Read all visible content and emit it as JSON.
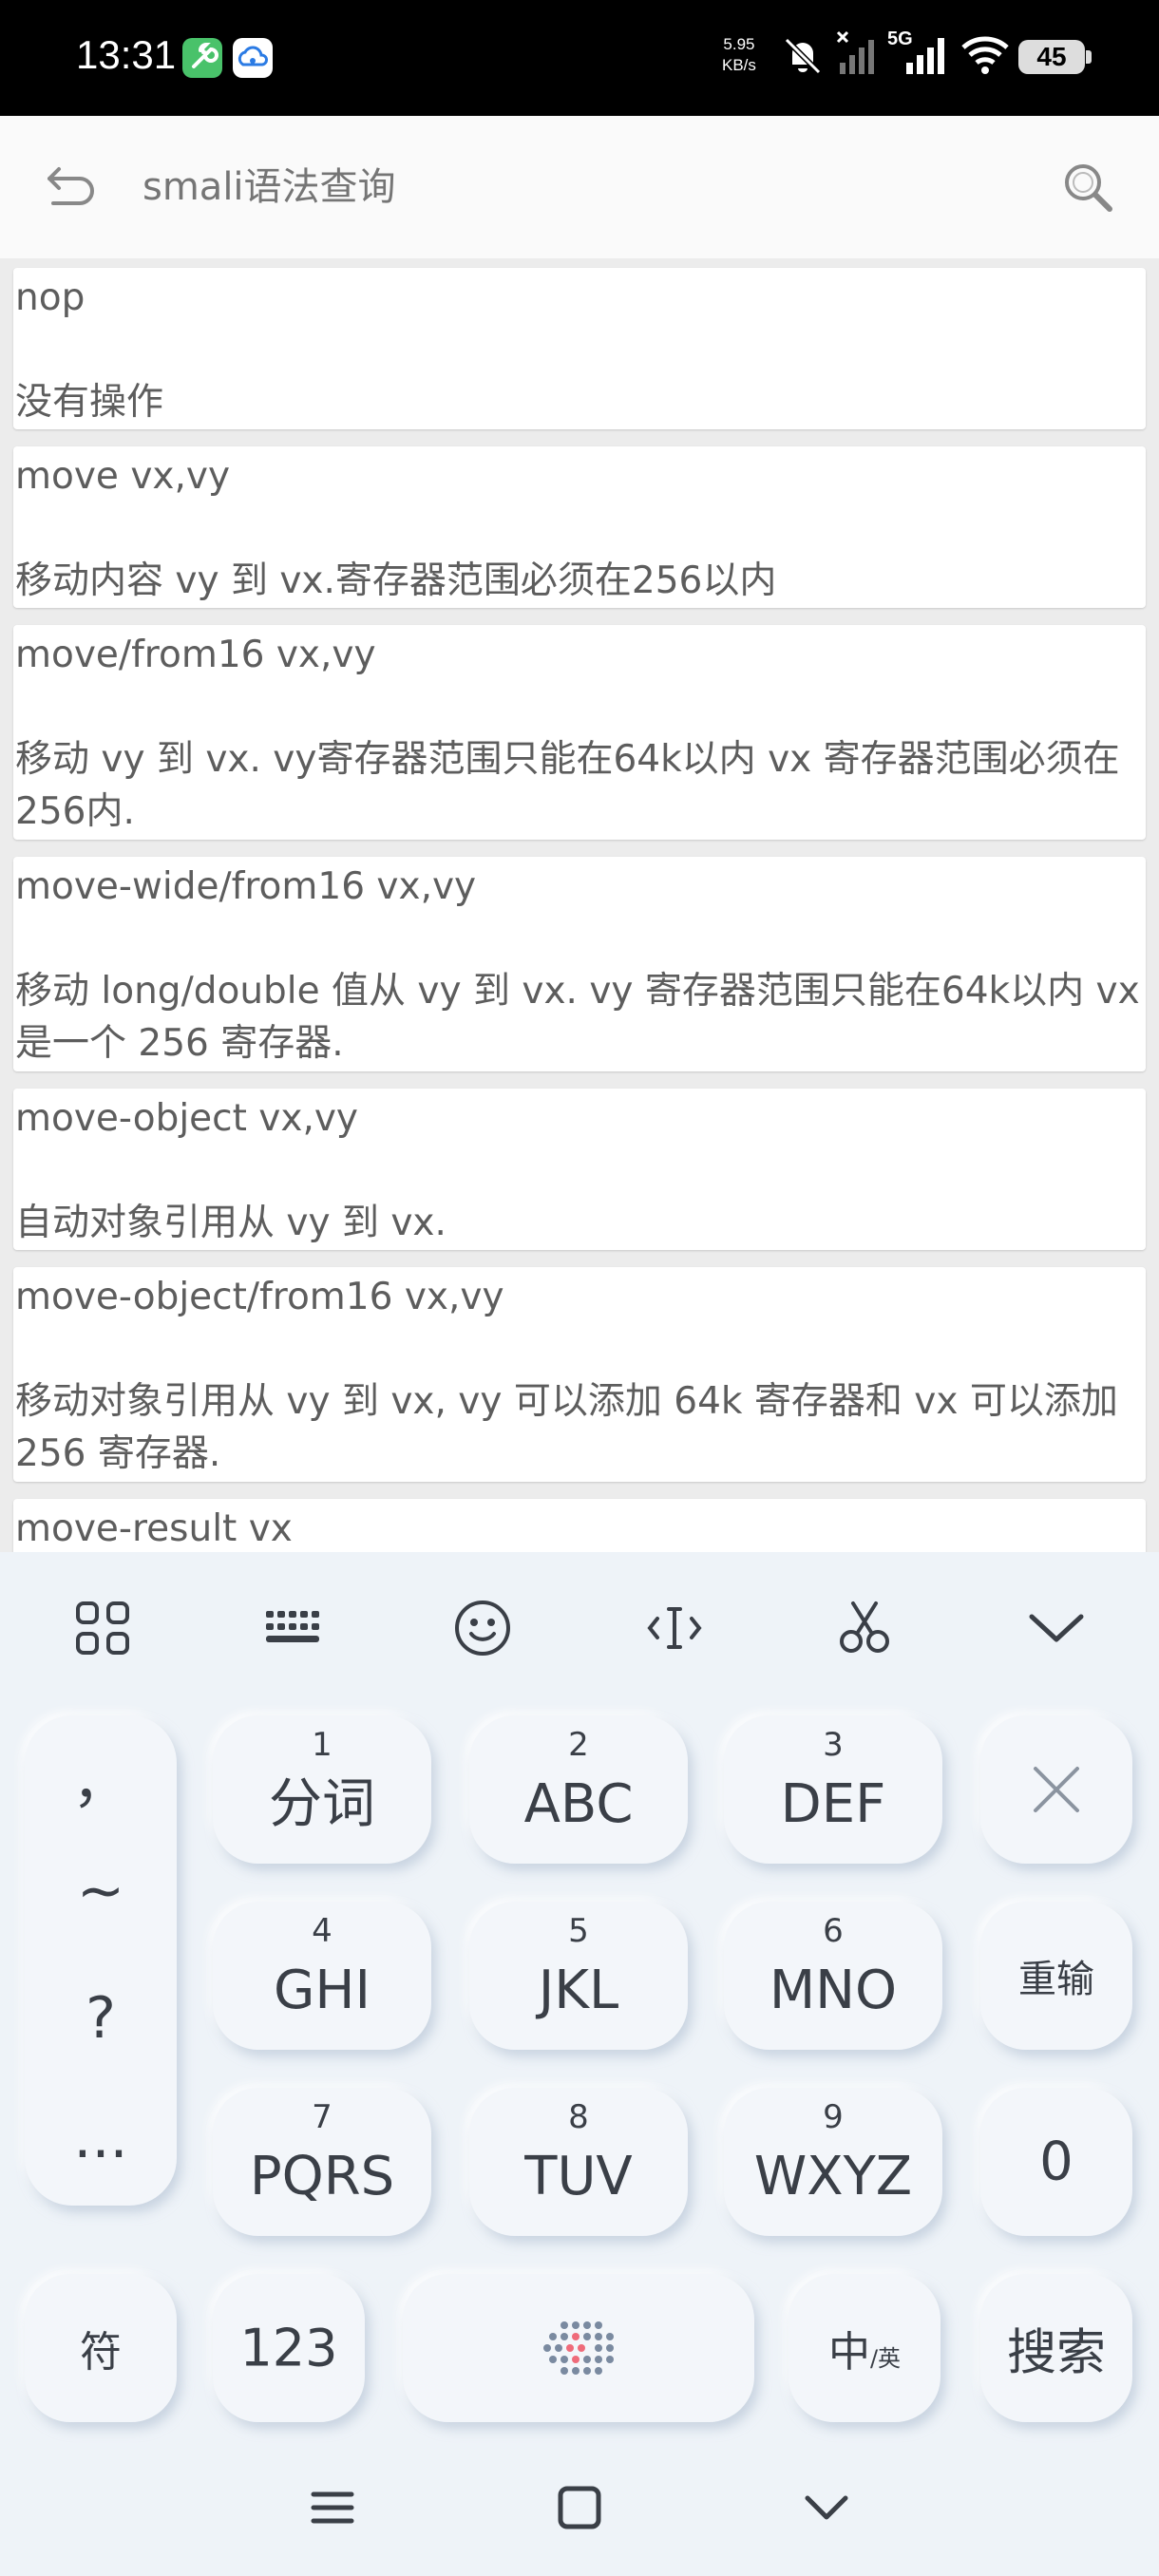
{
  "status_bar": {
    "time": "13:31",
    "net_speed_value": "5.95",
    "net_speed_unit": "KB/s",
    "network_label": "5G",
    "battery": "45"
  },
  "app_bar": {
    "search_placeholder": "smali语法查询"
  },
  "entries": [
    {
      "cmd": "nop",
      "desc": "没有操作"
    },
    {
      "cmd": "move vx,vy",
      "desc": "移动内容 vy 到 vx.寄存器范围必须在256以内"
    },
    {
      "cmd": "move/from16 vx,vy",
      "desc": "移动 vy 到 vx. vy寄存器范围只能在64k以内 vx 寄存器范围必须在256内."
    },
    {
      "cmd": "move-wide/from16 vx,vy",
      "desc": "移动 long/double 值从 vy 到 vx. vy 寄存器范围只能在64k以内 vx是一个 256 寄存器."
    },
    {
      "cmd": "move-object vx,vy",
      "desc": "自动对象引用从 vy 到 vx."
    },
    {
      "cmd": "move-object/from16 vx,vy",
      "desc": "移动对象引用从 vy 到 vx, vy 可以添加 64k 寄存器和 vx 可以添加 256 寄存器."
    },
    {
      "cmd": "move-result vx",
      "desc": ""
    }
  ],
  "keyboard": {
    "punctuation": [
      "，",
      "~",
      "?",
      "..."
    ],
    "keys": [
      {
        "num": "1",
        "label": "分词"
      },
      {
        "num": "2",
        "label": "ABC"
      },
      {
        "num": "3",
        "label": "DEF"
      },
      {
        "num": "4",
        "label": "GHI"
      },
      {
        "num": "5",
        "label": "JKL"
      },
      {
        "num": "6",
        "label": "MNO"
      },
      {
        "num": "7",
        "label": "PQRS"
      },
      {
        "num": "8",
        "label": "TUV"
      },
      {
        "num": "9",
        "label": "WXYZ"
      }
    ],
    "reinput": "重输",
    "zero": "0",
    "symbols": "符",
    "numbers": "123",
    "lang_main": "中",
    "lang_sub": "/英",
    "search": "搜索"
  },
  "colors": {
    "status_bg": "#000000",
    "app_bar_bg": "#fafafa",
    "list_bg": "#ececec",
    "card_text": "#5d5d5d",
    "keyboard_bg": "#eef3f8",
    "key_text": "#3a3f47",
    "space_dot_accent": "#ef6b7a"
  }
}
